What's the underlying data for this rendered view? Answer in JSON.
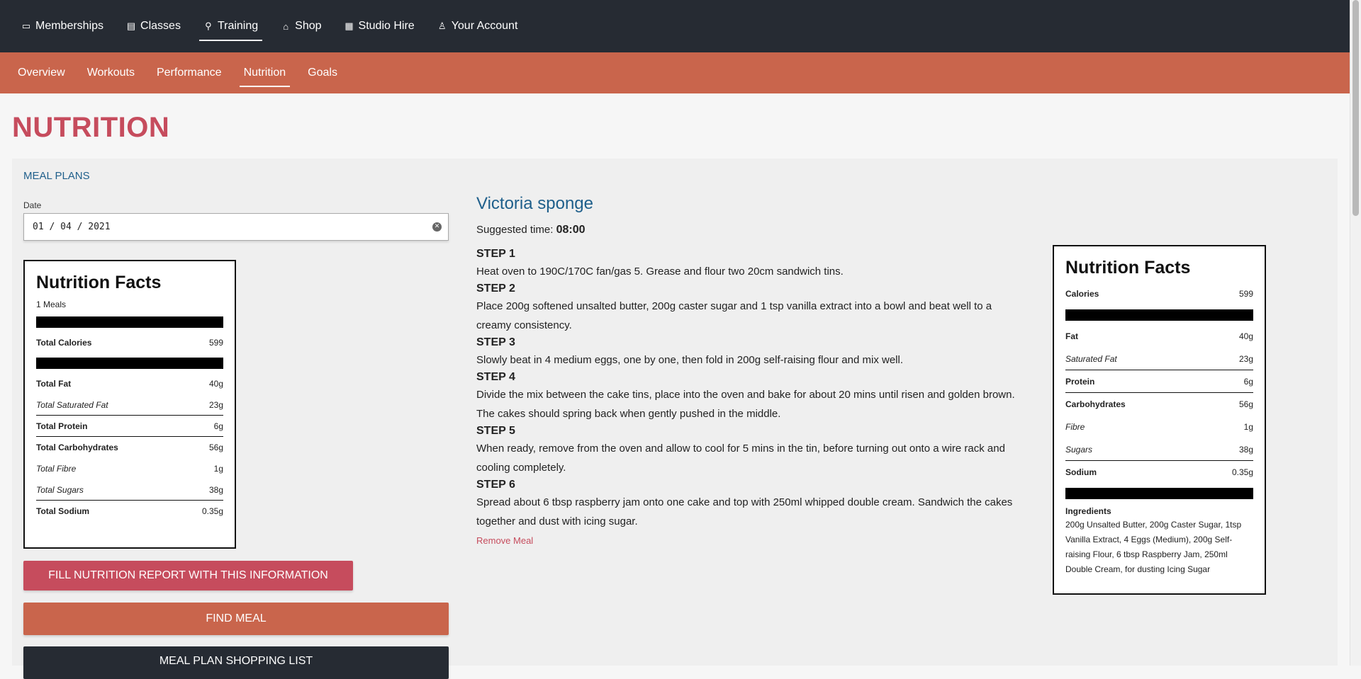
{
  "topnav": {
    "items": [
      {
        "label": "Memberships",
        "icon": "wallet-icon",
        "glyph": "▭"
      },
      {
        "label": "Classes",
        "icon": "calendar-icon",
        "glyph": "▤"
      },
      {
        "label": "Training",
        "icon": "running-icon",
        "glyph": "⚲"
      },
      {
        "label": "Shop",
        "icon": "basket-icon",
        "glyph": "⌂"
      },
      {
        "label": "Studio Hire",
        "icon": "building-icon",
        "glyph": "▦"
      },
      {
        "label": "Your Account",
        "icon": "user-icon",
        "glyph": "♙"
      }
    ],
    "active": "Training"
  },
  "subnav": {
    "items": [
      "Overview",
      "Workouts",
      "Performance",
      "Nutrition",
      "Goals"
    ],
    "active": "Nutrition"
  },
  "page": {
    "title": "NUTRITION",
    "meal_plans_link": "MEAL PLANS"
  },
  "date": {
    "label": "Date",
    "value": "01 / 04 / 2021"
  },
  "summary_facts": {
    "title": "Nutrition Facts",
    "meals": "1 Meals",
    "calories": {
      "label": "Total Calories",
      "value": "599"
    },
    "rows": [
      {
        "label": "Total Fat",
        "value": "40g",
        "style": "bold"
      },
      {
        "label": "Total Saturated Fat",
        "value": "23g",
        "style": "ital"
      },
      {
        "label": "Total Protein",
        "value": "6g",
        "style": "bold"
      },
      {
        "label": "Total Carbohydrates",
        "value": "56g",
        "style": "bold"
      },
      {
        "label": "Total Fibre",
        "value": "1g",
        "style": "ital"
      },
      {
        "label": "Total Sugars",
        "value": "38g",
        "style": "ital"
      },
      {
        "label": "Total Sodium",
        "value": "0.35g",
        "style": "bold"
      }
    ]
  },
  "buttons": {
    "fill_report": "FILL NUTRITION REPORT WITH THIS INFORMATION",
    "find_meal": "FIND MEAL",
    "shopping_list": "MEAL PLAN SHOPPING LIST"
  },
  "recipe": {
    "title": "Victoria sponge",
    "suggested_label": "Suggested time:",
    "suggested_time": "08:00",
    "steps": [
      {
        "title": "STEP 1",
        "text": "Heat oven to 190C/170C fan/gas 5. Grease and flour two 20cm sandwich tins."
      },
      {
        "title": "STEP 2",
        "text": "Place 200g softened unsalted butter, 200g caster sugar and 1 tsp vanilla extract into a bowl and beat well to a creamy consistency."
      },
      {
        "title": "STEP 3",
        "text": "Slowly beat in 4 medium eggs, one by one, then fold in 200g self-raising flour and mix well."
      },
      {
        "title": "STEP 4",
        "text": "Divide the mix between the cake tins, place into the oven and bake for about 20 mins until risen and golden brown. The cakes should spring back when gently pushed in the middle."
      },
      {
        "title": "STEP 5",
        "text": "When ready, remove from the oven and allow to cool for 5 mins in the tin, before turning out onto a wire rack and cooling completely."
      },
      {
        "title": "STEP 6",
        "text": "Spread about 6 tbsp raspberry jam onto one cake and top with 250ml whipped double cream. Sandwich the cakes together and dust with icing sugar."
      }
    ],
    "remove_label": "Remove Meal"
  },
  "meal_facts": {
    "title": "Nutrition Facts",
    "calories": {
      "label": "Calories",
      "value": "599"
    },
    "rows": [
      {
        "label": "Fat",
        "value": "40g",
        "style": "bold"
      },
      {
        "label": "Saturated Fat",
        "value": "23g",
        "style": "ital"
      },
      {
        "label": "Protein",
        "value": "6g",
        "style": "bold"
      },
      {
        "label": "Carbohydrates",
        "value": "56g",
        "style": "bold"
      },
      {
        "label": "Fibre",
        "value": "1g",
        "style": "ital"
      },
      {
        "label": "Sugars",
        "value": "38g",
        "style": "ital"
      },
      {
        "label": "Sodium",
        "value": "0.35g",
        "style": "bold"
      }
    ],
    "ingredients_title": "Ingredients",
    "ingredients": "200g Unsalted Butter, 200g Caster Sugar, 1tsp Vanilla Extract, 4 Eggs (Medium), 200g Self-raising Flour, 6 tbsp Raspberry Jam, 250ml Double Cream, for dusting Icing Sugar"
  },
  "colors": {
    "topnav_bg": "#262b33",
    "subnav_bg": "#c9654c",
    "title_red": "#c64c5d",
    "link_blue": "#1f5f8b"
  }
}
